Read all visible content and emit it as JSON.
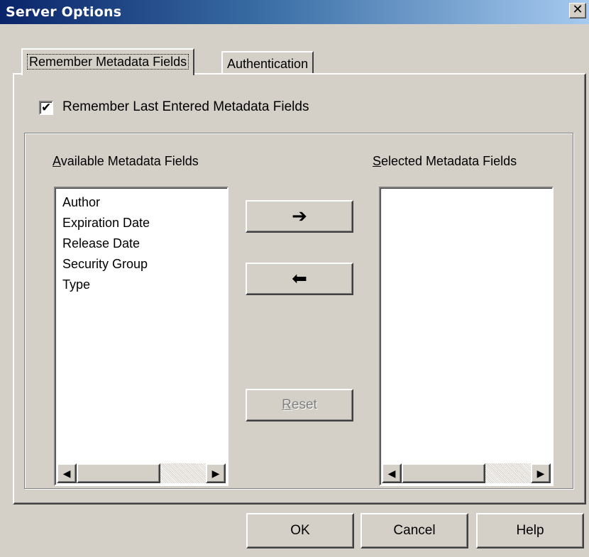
{
  "window": {
    "title": "Server Options",
    "close_glyph": "✕"
  },
  "tabs": [
    {
      "label": "Remember Metadata Fields",
      "active": true
    },
    {
      "label": "Authentication",
      "active": false
    }
  ],
  "checkbox": {
    "label": "Remember Last Entered Metadata Fields",
    "checked": true
  },
  "available": {
    "label_mnemonic": "A",
    "label_rest": "vailable Metadata Fields",
    "items": [
      "Author",
      "Expiration Date",
      "Release Date",
      "Security Group",
      "Type"
    ]
  },
  "selected": {
    "label_mnemonic": "S",
    "label_rest": "elected Metadata Fields",
    "items": []
  },
  "buttons": {
    "add_glyph": "➔",
    "remove_glyph": "⬅",
    "reset_mnemonic": "R",
    "reset_rest": "eset",
    "ok": "OK",
    "cancel": "Cancel",
    "help": "Help"
  },
  "scroll_glyphs": {
    "left": "◀",
    "right": "▶"
  },
  "colors": {
    "titlebar_start": "#0a246a",
    "titlebar_end": "#a6caf0",
    "face": "#d4d0c8",
    "disabled_text": "#808080"
  }
}
